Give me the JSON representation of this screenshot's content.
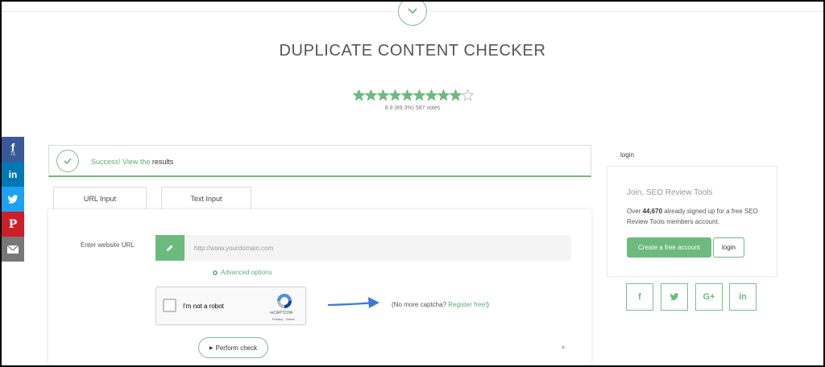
{
  "page": {
    "title": "DUPLICATE CONTENT CHECKER",
    "rating": {
      "text": "8.9 (89.3%) 587 votes",
      "stars_filled": 9,
      "stars_total": 10
    }
  },
  "social": [
    {
      "icon": "facebook-icon",
      "glyph": "f",
      "count": "71",
      "color": "#3b5998"
    },
    {
      "icon": "linkedin-icon",
      "glyph": "in",
      "count": "",
      "color": "#0077b5"
    },
    {
      "icon": "twitter-icon",
      "glyph": "",
      "count": "",
      "color": "#1da1f2"
    },
    {
      "icon": "pinterest-icon",
      "glyph": "P",
      "count": "",
      "color": "#cb2027"
    },
    {
      "icon": "email-icon",
      "glyph": "",
      "count": "",
      "color": "#777777"
    }
  ],
  "success": {
    "text": "Success! View the ",
    "link": "results"
  },
  "tabs": {
    "url": "URL Input",
    "text": "Text Input"
  },
  "form": {
    "url_label": "Enter website URL",
    "url_placeholder": "http://www.yourdomain.com",
    "advanced": "Advanced options",
    "captcha_label": "I'm not a robot",
    "captcha_brand": "reCAPTCHA",
    "captcha_terms": "Privacy - Terms",
    "nomore_prefix": "(No more captcha? ",
    "nomore_link": "Register free!",
    "nomore_suffix": ")",
    "perform": "Perform check"
  },
  "sidebar": {
    "login_link": "login",
    "join_title": "Join, SEO Review Tools",
    "join_desc_pre": "Over ",
    "join_count": "44,670",
    "join_desc_post": " already signed up for a free SEO Review Tools members account.",
    "create_btn": "Create a free account",
    "login_btn": "login",
    "share_icons": [
      "facebook-icon",
      "twitter-icon",
      "google-plus-icon",
      "linkedin-icon"
    ]
  },
  "colors": {
    "accent": "#6dba7e",
    "text": "#555555"
  }
}
